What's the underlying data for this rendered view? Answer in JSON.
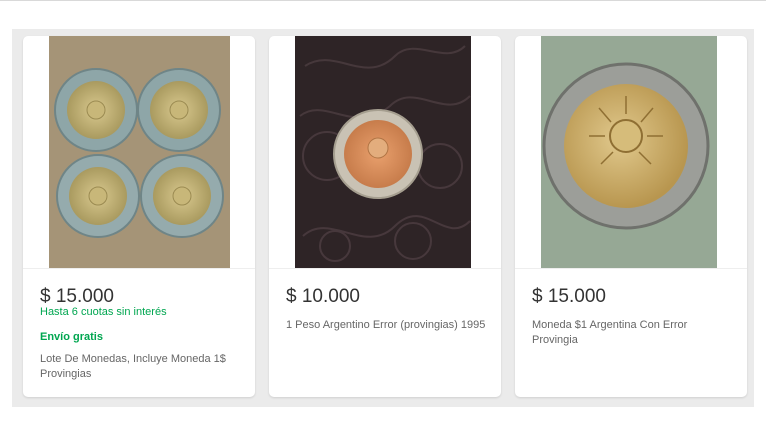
{
  "listings": [
    {
      "image_alt": "coins-photo-four-coins",
      "price": "$ 15.000",
      "installments": "Hasta 6 cuotas sin interés",
      "shipping": "Envío gratis",
      "title": "Lote De Monedas, Incluye Moneda 1$ Provingias"
    },
    {
      "image_alt": "coin-photo-on-leather",
      "price": "$ 10.000",
      "title": "1 Peso Argentino Error (provingias) 1995"
    },
    {
      "image_alt": "coin-photo-closeup",
      "price": "$ 15.000",
      "title": "Moneda $1 Argentina Con Error Provingia"
    }
  ],
  "colors": {
    "price": "#333333",
    "installments": "#00a650",
    "shipping": "#00a650",
    "title": "#666666",
    "panel_bg": "#ebebeb"
  }
}
